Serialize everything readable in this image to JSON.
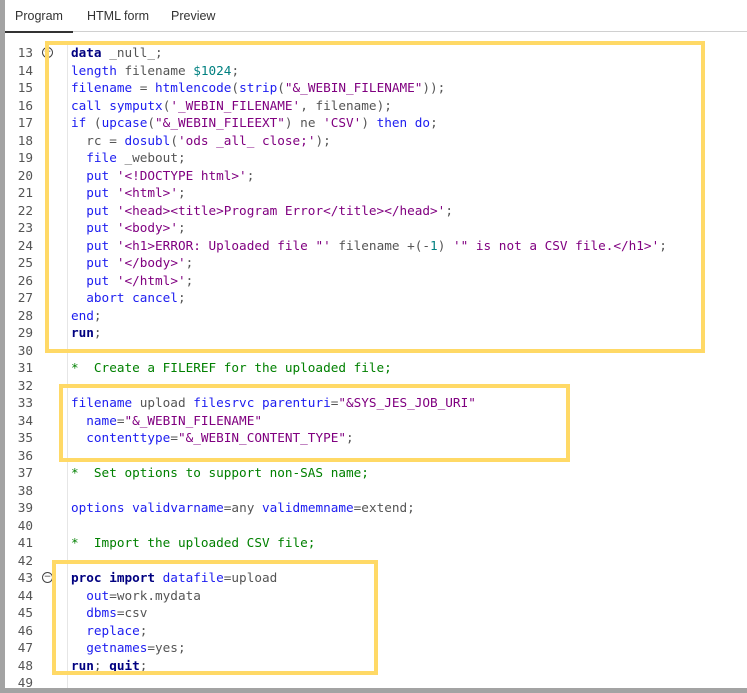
{
  "tabs": [
    {
      "label": "Program",
      "active": true
    },
    {
      "label": "HTML form"
    },
    {
      "label": "Preview"
    }
  ],
  "colors": {
    "highlight": "#ffd966",
    "keyword": "#1c1cf0",
    "bold_keyword": "#000080",
    "string": "#800080",
    "comment": "#008000",
    "number": "#008080"
  },
  "lines": [
    {
      "n": "13",
      "fold": "minus",
      "t": [
        [
          "bk",
          "data"
        ],
        [
          "tx",
          " _null_;"
        ]
      ]
    },
    {
      "n": "14",
      "t": [
        [
          "kw",
          "length"
        ],
        [
          "tx",
          " filename "
        ],
        [
          "nm",
          "$1024"
        ],
        [
          "tx",
          ";"
        ]
      ]
    },
    {
      "n": "15",
      "t": [
        [
          "kw",
          "filename"
        ],
        [
          "tx",
          " = "
        ],
        [
          "kw",
          "htmlencode"
        ],
        [
          "tx",
          "("
        ],
        [
          "kw",
          "strip"
        ],
        [
          "tx",
          "("
        ],
        [
          "st",
          "\"&_WEBIN_FILENAME\""
        ],
        [
          "tx",
          "));"
        ]
      ]
    },
    {
      "n": "16",
      "t": [
        [
          "kw",
          "call"
        ],
        [
          "tx",
          " "
        ],
        [
          "kw",
          "symputx"
        ],
        [
          "tx",
          "("
        ],
        [
          "st",
          "'_WEBIN_FILENAME'"
        ],
        [
          "tx",
          ", filename);"
        ]
      ]
    },
    {
      "n": "17",
      "t": [
        [
          "kw",
          "if"
        ],
        [
          "tx",
          " ("
        ],
        [
          "kw",
          "upcase"
        ],
        [
          "tx",
          "("
        ],
        [
          "st",
          "\"&_WEBIN_FILEEXT\""
        ],
        [
          "tx",
          ") ne "
        ],
        [
          "st",
          "'CSV'"
        ],
        [
          "tx",
          ") "
        ],
        [
          "kw",
          "then do"
        ],
        [
          "tx",
          ";"
        ]
      ]
    },
    {
      "n": "18",
      "t": [
        [
          "tx",
          "  rc = "
        ],
        [
          "kw",
          "dosubl"
        ],
        [
          "tx",
          "("
        ],
        [
          "st",
          "'ods _all_ close;'"
        ],
        [
          "tx",
          ");"
        ]
      ]
    },
    {
      "n": "19",
      "t": [
        [
          "tx",
          "  "
        ],
        [
          "kw",
          "file"
        ],
        [
          "tx",
          " _webout;"
        ]
      ]
    },
    {
      "n": "20",
      "t": [
        [
          "tx",
          "  "
        ],
        [
          "kw",
          "put"
        ],
        [
          "tx",
          " "
        ],
        [
          "st",
          "'<!DOCTYPE html>'"
        ],
        [
          "tx",
          ";"
        ]
      ]
    },
    {
      "n": "21",
      "t": [
        [
          "tx",
          "  "
        ],
        [
          "kw",
          "put"
        ],
        [
          "tx",
          " "
        ],
        [
          "st",
          "'<html>'"
        ],
        [
          "tx",
          ";"
        ]
      ]
    },
    {
      "n": "22",
      "t": [
        [
          "tx",
          "  "
        ],
        [
          "kw",
          "put"
        ],
        [
          "tx",
          " "
        ],
        [
          "st",
          "'<head><title>Program Error</title></head>'"
        ],
        [
          "tx",
          ";"
        ]
      ]
    },
    {
      "n": "23",
      "t": [
        [
          "tx",
          "  "
        ],
        [
          "kw",
          "put"
        ],
        [
          "tx",
          " "
        ],
        [
          "st",
          "'<body>'"
        ],
        [
          "tx",
          ";"
        ]
      ]
    },
    {
      "n": "24",
      "t": [
        [
          "tx",
          "  "
        ],
        [
          "kw",
          "put"
        ],
        [
          "tx",
          " "
        ],
        [
          "st",
          "'<h1>ERROR: Uploaded file \"'"
        ],
        [
          "tx",
          " filename +(-"
        ],
        [
          "nm",
          "1"
        ],
        [
          "tx",
          ") "
        ],
        [
          "st",
          "'\" is not a CSV file.</h1>'"
        ],
        [
          "tx",
          ";"
        ]
      ]
    },
    {
      "n": "25",
      "t": [
        [
          "tx",
          "  "
        ],
        [
          "kw",
          "put"
        ],
        [
          "tx",
          " "
        ],
        [
          "st",
          "'</body>'"
        ],
        [
          "tx",
          ";"
        ]
      ]
    },
    {
      "n": "26",
      "t": [
        [
          "tx",
          "  "
        ],
        [
          "kw",
          "put"
        ],
        [
          "tx",
          " "
        ],
        [
          "st",
          "'</html>'"
        ],
        [
          "tx",
          ";"
        ]
      ]
    },
    {
      "n": "27",
      "t": [
        [
          "tx",
          "  "
        ],
        [
          "kw",
          "abort cancel"
        ],
        [
          "tx",
          ";"
        ]
      ]
    },
    {
      "n": "28",
      "t": [
        [
          "kw",
          "end"
        ],
        [
          "tx",
          ";"
        ]
      ]
    },
    {
      "n": "29",
      "t": [
        [
          "bk",
          "run"
        ],
        [
          "tx",
          ";"
        ]
      ]
    },
    {
      "n": "30",
      "t": []
    },
    {
      "n": "31",
      "t": [
        [
          "cm",
          "*  Create a FILEREF for the uploaded file;"
        ]
      ]
    },
    {
      "n": "32",
      "t": []
    },
    {
      "n": "33",
      "t": [
        [
          "kw",
          "filename"
        ],
        [
          "tx",
          " upload "
        ],
        [
          "kw",
          "filesrvc"
        ],
        [
          "tx",
          " "
        ],
        [
          "kw",
          "parenturi"
        ],
        [
          "tx",
          "="
        ],
        [
          "st",
          "\"&SYS_JES_JOB_URI\""
        ]
      ]
    },
    {
      "n": "34",
      "t": [
        [
          "tx",
          "  "
        ],
        [
          "kw",
          "name"
        ],
        [
          "tx",
          "="
        ],
        [
          "st",
          "\"&_WEBIN_FILENAME\""
        ]
      ]
    },
    {
      "n": "35",
      "t": [
        [
          "tx",
          "  "
        ],
        [
          "kw",
          "contenttype"
        ],
        [
          "tx",
          "="
        ],
        [
          "st",
          "\"&_WEBIN_CONTENT_TYPE\""
        ],
        [
          "tx",
          ";"
        ]
      ]
    },
    {
      "n": "36",
      "t": []
    },
    {
      "n": "37",
      "t": [
        [
          "cm",
          "*  Set options to support non-SAS name;"
        ]
      ]
    },
    {
      "n": "38",
      "t": []
    },
    {
      "n": "39",
      "t": [
        [
          "kw",
          "options"
        ],
        [
          "tx",
          " "
        ],
        [
          "kw",
          "validvarname"
        ],
        [
          "tx",
          "=any "
        ],
        [
          "kw",
          "validmemname"
        ],
        [
          "tx",
          "=extend;"
        ]
      ]
    },
    {
      "n": "40",
      "t": []
    },
    {
      "n": "41",
      "t": [
        [
          "cm",
          "*  Import the uploaded CSV file;"
        ]
      ]
    },
    {
      "n": "42",
      "t": []
    },
    {
      "n": "43",
      "fold": "minus",
      "t": [
        [
          "bk",
          "proc import"
        ],
        [
          "tx",
          " "
        ],
        [
          "kw",
          "datafile"
        ],
        [
          "tx",
          "=upload"
        ]
      ]
    },
    {
      "n": "44",
      "t": [
        [
          "tx",
          "  "
        ],
        [
          "kw",
          "out"
        ],
        [
          "tx",
          "=work.mydata"
        ]
      ]
    },
    {
      "n": "45",
      "t": [
        [
          "tx",
          "  "
        ],
        [
          "kw",
          "dbms"
        ],
        [
          "tx",
          "=csv"
        ]
      ]
    },
    {
      "n": "46",
      "t": [
        [
          "tx",
          "  "
        ],
        [
          "kw",
          "replace"
        ],
        [
          "tx",
          ";"
        ]
      ]
    },
    {
      "n": "47",
      "t": [
        [
          "tx",
          "  "
        ],
        [
          "kw",
          "getnames"
        ],
        [
          "tx",
          "=yes;"
        ]
      ]
    },
    {
      "n": "48",
      "t": [
        [
          "bk",
          "run"
        ],
        [
          "tx",
          "; "
        ],
        [
          "bk",
          "quit"
        ],
        [
          "tx",
          ";"
        ]
      ]
    },
    {
      "n": "49",
      "t": []
    }
  ]
}
